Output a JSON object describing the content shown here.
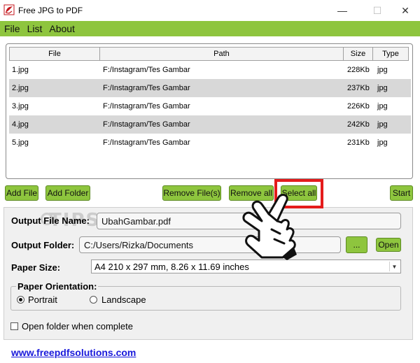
{
  "window": {
    "title": "Free JPG to PDF",
    "minimize_glyph": "—",
    "maximize_glyph": "☐",
    "close_glyph": "✕"
  },
  "menu": [
    "File",
    "List",
    "About"
  ],
  "table": {
    "columns": [
      "File",
      "Path",
      "Size",
      "Type"
    ],
    "rows": [
      [
        "1.jpg",
        "F:/Instagram/Tes Gambar",
        "228Kb",
        "jpg"
      ],
      [
        "2.jpg",
        "F:/Instagram/Tes Gambar",
        "237Kb",
        "jpg"
      ],
      [
        "3.jpg",
        "F:/Instagram/Tes Gambar",
        "226Kb",
        "jpg"
      ],
      [
        "4.jpg",
        "F:/Instagram/Tes Gambar",
        "242Kb",
        "jpg"
      ],
      [
        "5.jpg",
        "F:/Instagram/Tes Gambar",
        "231Kb",
        "jpg"
      ]
    ]
  },
  "buttons": {
    "add_file": "Add File",
    "add_folder": "Add Folder",
    "remove_files": "Remove File(s)",
    "remove_all": "Remove all",
    "select_all": "Select all",
    "start": "Start",
    "browse": "...",
    "open": "Open"
  },
  "settings": {
    "output_file_name_label": "Output File Name:",
    "output_file_name_value": "UbahGambar.pdf",
    "output_folder_label": "Output Folder:",
    "output_folder_value": "C:/Users/Rizka/Documents",
    "paper_size_label": "Paper Size:",
    "paper_size_value": "A4 210 x 297 mm, 8.26 x 11.69 inches",
    "orientation_label": "Paper Orientation:",
    "orientation_portrait": "Portrait",
    "orientation_landscape": "Landscape",
    "orientation_selected": "Portrait",
    "open_when_complete_label": "Open folder when complete",
    "open_when_complete_checked": false
  },
  "watermark": "TIPS PINTAR",
  "footer_link": "www.freepdfsolutions.com",
  "colors": {
    "accent_green": "#8ec53e",
    "highlight_red": "#e41b1b",
    "link_blue": "#1a1adb"
  },
  "icons": {
    "app": "pdf-app-icon",
    "cursor": "hand-pointer-icon"
  }
}
